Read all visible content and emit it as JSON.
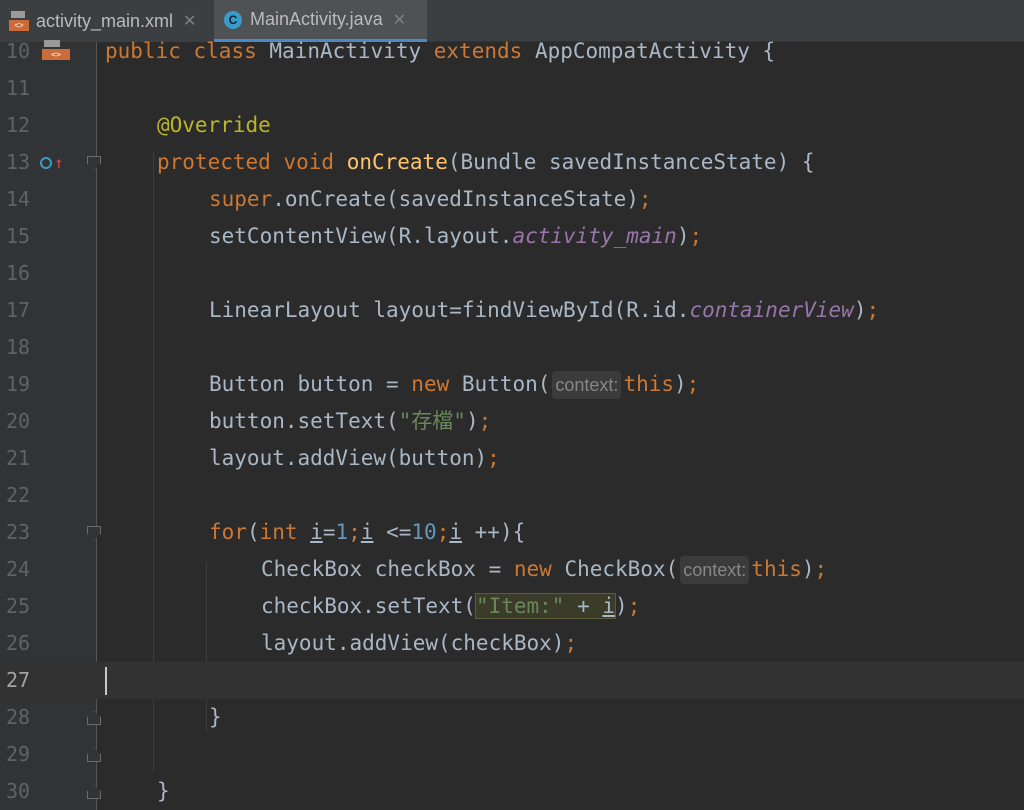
{
  "tabs": [
    {
      "label": "activity_main.xml",
      "icon": "xml-file-icon",
      "active": false
    },
    {
      "label": "MainActivity.java",
      "icon": "java-class-icon",
      "active": true
    }
  ],
  "editor": {
    "line_numbers": [
      "10",
      "11",
      "12",
      "13",
      "14",
      "15",
      "16",
      "17",
      "18",
      "19",
      "20",
      "21",
      "22",
      "23",
      "24",
      "25",
      "26",
      "27",
      "28",
      "29",
      "30"
    ],
    "current_line": "27",
    "tokens": {
      "l10_public": "public",
      "l10_class": "class",
      "l10_name": "MainActivity",
      "l10_extends": "extends",
      "l10_super": "AppCompatActivity",
      "l10_brace": " {",
      "l12_override": "@Override",
      "l13_protected": "protected",
      "l13_void": "void",
      "l13_method": "onCreate",
      "l13_params": "(Bundle savedInstanceState) {",
      "l14_super": "super",
      "l14_rest": ".onCreate(savedInstanceState)",
      "l14_semi": ";",
      "l15_a": "setContentView(R.layout.",
      "l15_field": "activity_main",
      "l15_b": ")",
      "l15_semi": ";",
      "l17_a": "LinearLayout layout=findViewById(R.id.",
      "l17_field": "containerView",
      "l17_b": ")",
      "l17_semi": ";",
      "l19_a": "Button button = ",
      "l19_new": "new",
      "l19_b": " Button(",
      "l19_hint": "context:",
      "l19_this": "this",
      "l19_c": ")",
      "l19_semi": ";",
      "l20_a": "button.setText(",
      "l20_str": "\"存檔\"",
      "l20_b": ")",
      "l20_semi": ";",
      "l21_a": "layout.addView(button)",
      "l21_semi": ";",
      "l23_for": "for",
      "l23_a": "(",
      "l23_int": "int",
      "l23_sp": " ",
      "l23_i1": "i",
      "l23_eq": "=",
      "l23_one": "1",
      "l23_s1": ";",
      "l23_i2": "i",
      "l23_lt": " <=",
      "l23_ten": "10",
      "l23_s2": ";",
      "l23_i3": "i",
      "l23_end": " ++){",
      "l24_a": "CheckBox checkBox = ",
      "l24_new": "new",
      "l24_b": " CheckBox(",
      "l24_hint": "context:",
      "l24_this": "this",
      "l24_c": ")",
      "l24_semi": ";",
      "l25_a": "checkBox.setText(",
      "l25_str": "\"Item:\"",
      "l25_plus": " + ",
      "l25_i": "i",
      "l25_b": ")",
      "l25_semi": ";",
      "l26_a": "layout.addView(checkBox)",
      "l26_semi": ";",
      "l28_brace": "}",
      "l30_brace": "}"
    }
  },
  "colors": {
    "background": "#2b2b2b",
    "keyword": "#cc7832",
    "method": "#ffc66d",
    "annotation": "#bbb529",
    "number": "#6897bb",
    "string": "#6a8759",
    "field": "#9876aa",
    "text": "#a9b7c6"
  },
  "icons": [
    "xml-file-icon",
    "java-class-icon",
    "close-icon",
    "override-icon",
    "fold-icon"
  ]
}
